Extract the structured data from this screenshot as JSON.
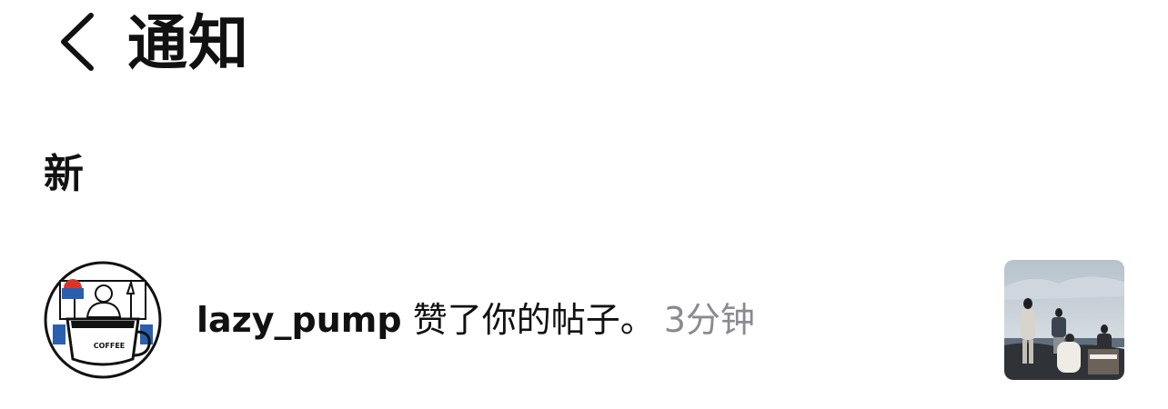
{
  "header": {
    "back_icon": "chevron-left-icon",
    "title": "通知"
  },
  "sections": [
    {
      "heading": "新",
      "items": [
        {
          "username": "lazy_pump",
          "action": " 赞了你的帖子。",
          "time": "3分钟",
          "avatar_logo_text": "COFFEE",
          "avatar_icon": "avatar-icon",
          "thumbnail_icon": "post-thumbnail-icon"
        }
      ]
    }
  ],
  "colors": {
    "text_primary": "#111111",
    "text_secondary": "#8a8a8f",
    "background": "#ffffff"
  }
}
